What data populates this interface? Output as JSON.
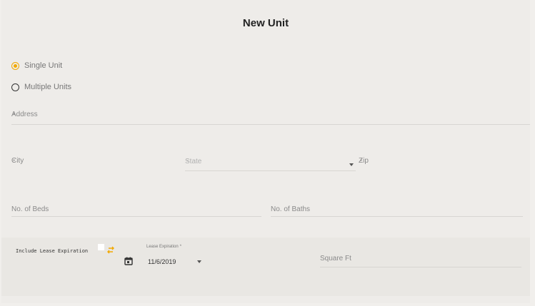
{
  "header": {
    "title": "New Unit"
  },
  "unit_type": {
    "options": [
      {
        "label": "Single Unit",
        "checked": true
      },
      {
        "label": "Multiple Units",
        "checked": false
      }
    ]
  },
  "form": {
    "address_label": "Address",
    "city_label": "City",
    "state_label": "State",
    "zip_label": "Zip",
    "required_marker": "*",
    "beds_label": "No. of Beds",
    "baths_label": "No. of Baths"
  },
  "lease": {
    "include_label": "Include Lease Expiration",
    "expiration_label": "Lease Expiration",
    "expiration_value": "11/6/2019",
    "square_ft_label": "Square Ft"
  },
  "colors": {
    "accent": "#f2a900",
    "background": "#eeece9"
  }
}
